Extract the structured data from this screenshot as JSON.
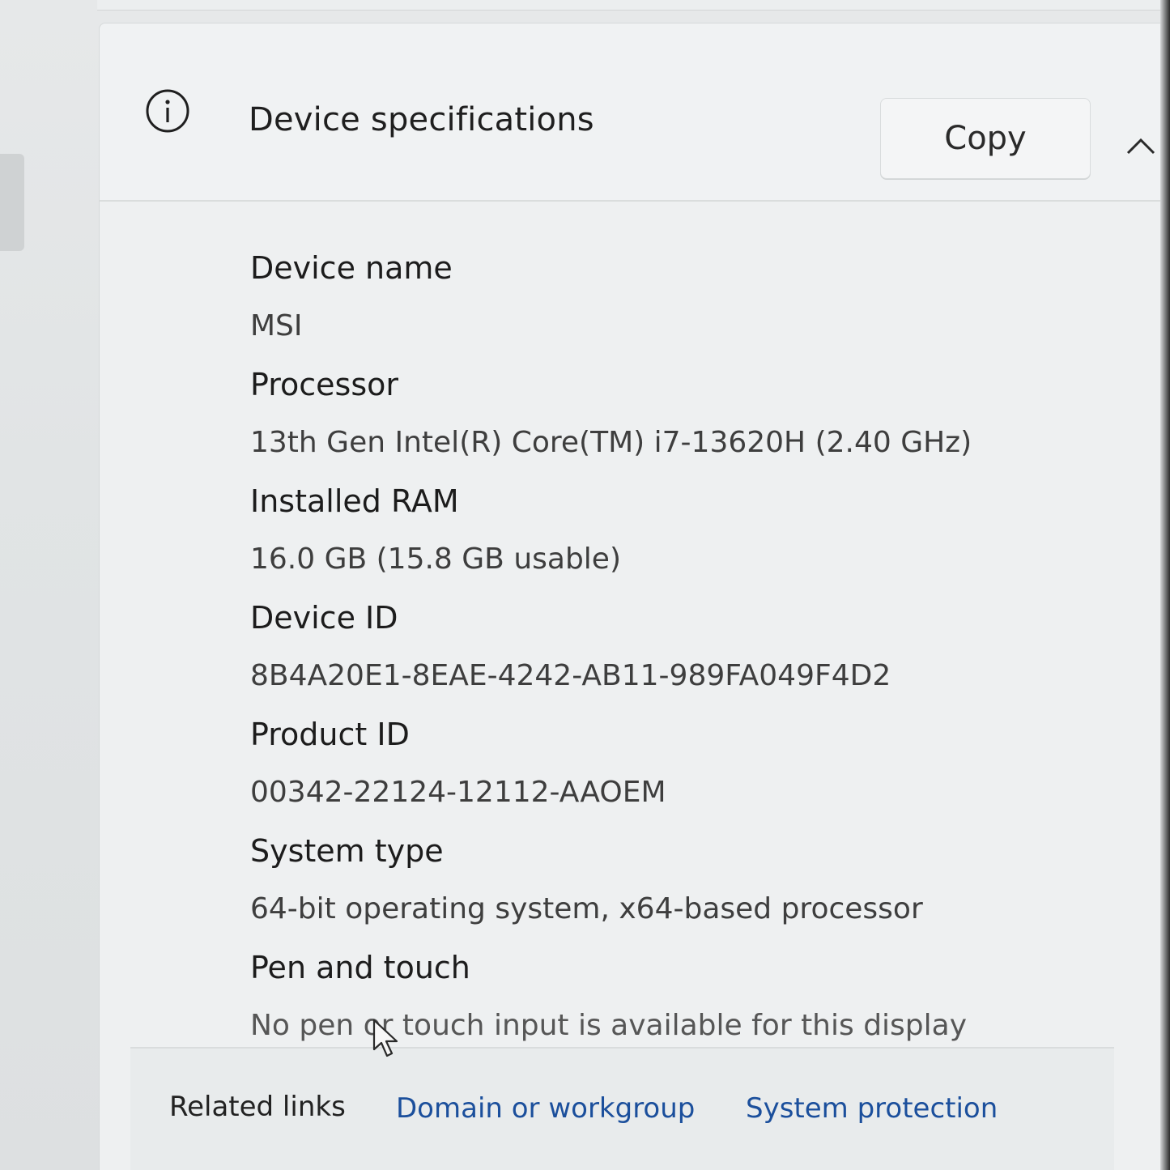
{
  "header": {
    "title": "Device specifications",
    "copy_label": "Copy",
    "icon": "info-icon",
    "collapse_icon": "chevron-up-icon"
  },
  "specs": [
    {
      "label": "Device name",
      "value": "MSI"
    },
    {
      "label": "Processor",
      "value": "13th Gen Intel(R) Core(TM) i7-13620H (2.40 GHz)"
    },
    {
      "label": "Installed RAM",
      "value": "16.0 GB (15.8 GB usable)"
    },
    {
      "label": "Device ID",
      "value": "8B4A20E1-8EAE-4242-AB11-989FA049F4D2"
    },
    {
      "label": "Product ID",
      "value": "00342-22124-12112-AAOEM"
    },
    {
      "label": "System type",
      "value": "64-bit operating system, x64-based processor"
    },
    {
      "label": "Pen and touch",
      "value": "No pen or touch input is available for this display"
    }
  ],
  "related_links": {
    "label": "Related links",
    "items": [
      "Domain or workgroup",
      "System protection"
    ]
  },
  "colors": {
    "link": "#1b4f9c",
    "card": "#eef0f1",
    "text": "#1c1c1c"
  }
}
